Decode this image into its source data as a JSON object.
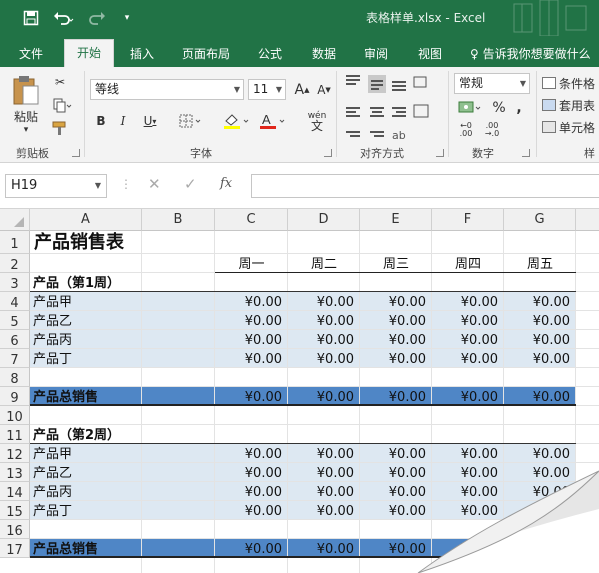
{
  "titlebar": {
    "title": "表格样单.xlsx - Excel",
    "colors": {
      "accent": "#217346"
    }
  },
  "tabs": [
    {
      "label": "文件"
    },
    {
      "label": "开始"
    },
    {
      "label": "插入"
    },
    {
      "label": "页面布局"
    },
    {
      "label": "公式"
    },
    {
      "label": "数据"
    },
    {
      "label": "审阅"
    },
    {
      "label": "视图"
    }
  ],
  "tell_me": "告诉我你想要做什么",
  "ribbon": {
    "clipboard": {
      "paste": "粘贴",
      "label": "剪贴板"
    },
    "font": {
      "name": "等线",
      "size": "11",
      "label": "字体",
      "phonetic": "wén"
    },
    "alignment": {
      "label": "对齐方式"
    },
    "number": {
      "format": "常规",
      "label": "数字"
    },
    "styles": {
      "cond": "条件格",
      "table": "套用表",
      "cell": "单元格",
      "label": "样"
    }
  },
  "formula_bar": {
    "name_box": "H19",
    "fx": "fx"
  },
  "sheet": {
    "columns": [
      "A",
      "B",
      "C",
      "D",
      "E",
      "F",
      "G"
    ],
    "rows": [
      "1",
      "2",
      "3",
      "4",
      "5",
      "6",
      "7",
      "8",
      "9",
      "10",
      "11",
      "12",
      "13",
      "14",
      "15",
      "16",
      "17"
    ],
    "title": "产品销售表",
    "days": [
      "周一",
      "周二",
      "周三",
      "周四",
      "周五"
    ],
    "week1": "产品（第1周）",
    "week2": "产品（第2周）",
    "products": [
      "产品甲",
      "产品乙",
      "产品丙",
      "产品丁"
    ],
    "total": "产品总销售",
    "value": "¥0.00",
    "colors": {
      "band": "#dde8f2",
      "total": "#4f86c6"
    }
  }
}
